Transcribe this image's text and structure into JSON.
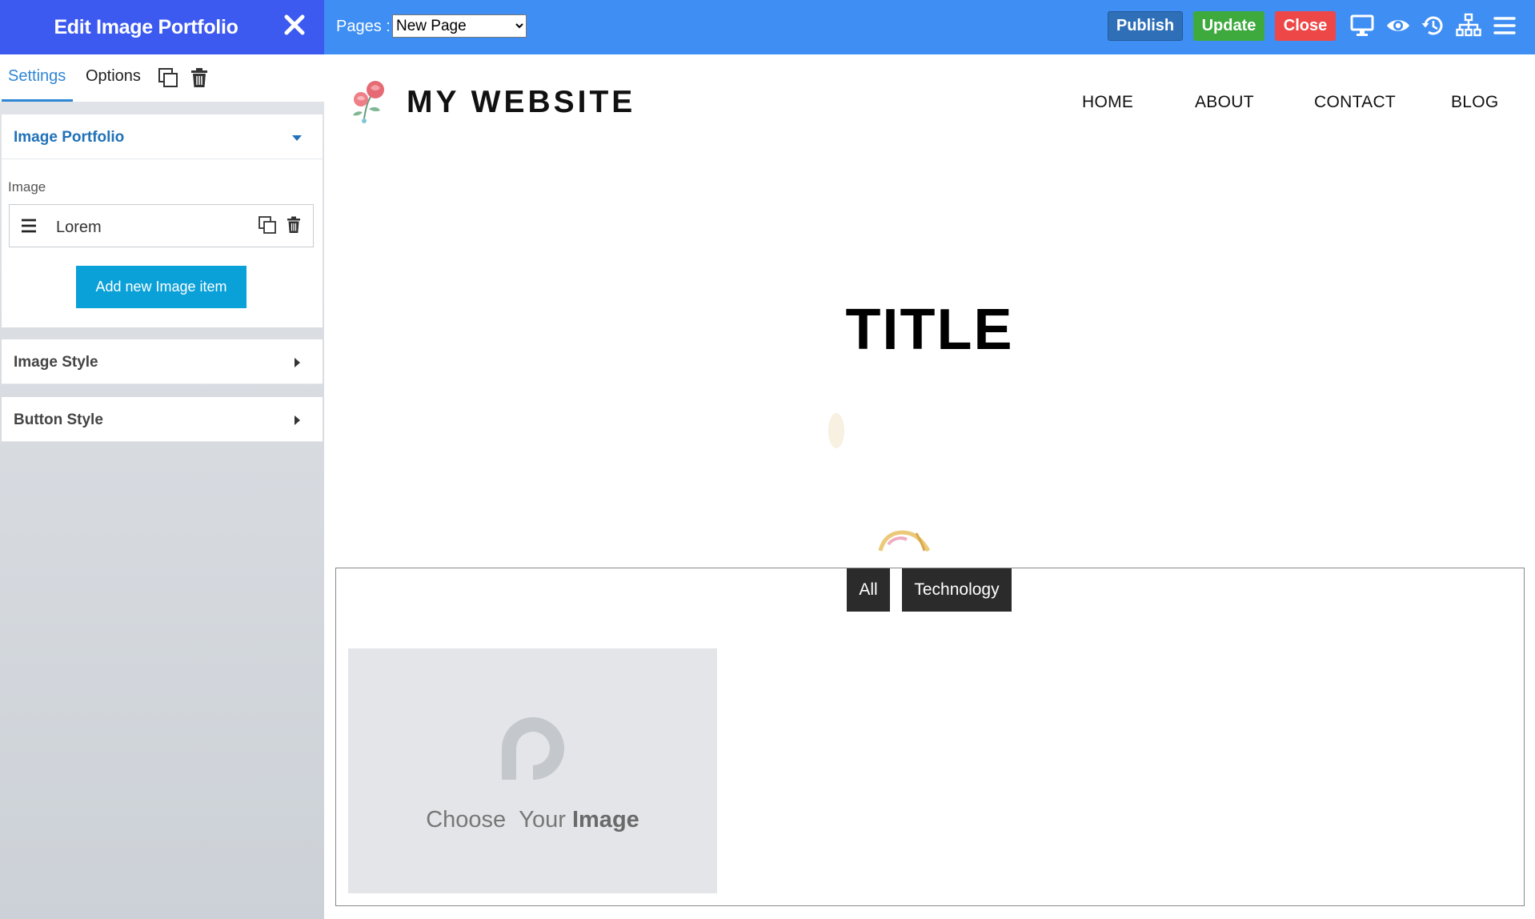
{
  "panel": {
    "title": "Edit Image Portfolio",
    "tabs": {
      "settings": "Settings",
      "options": "Options"
    },
    "sections": {
      "image_portfolio": "Image Portfolio",
      "image_style": "Image Style",
      "button_style": "Button Style"
    },
    "image_field_label": "Image",
    "items": [
      {
        "label": "Lorem"
      }
    ],
    "add_button": "Add new Image item",
    "collapse_glyph": "‹"
  },
  "topbar": {
    "pages_label": "Pages :",
    "pages_selected": "New Page",
    "buttons": {
      "publish": "Publish",
      "update": "Update",
      "close": "Close"
    },
    "icons": [
      "desktop-icon",
      "eye-icon",
      "history-icon",
      "sitemap-icon",
      "menu-icon"
    ]
  },
  "site": {
    "name": "MY WEBSITE",
    "nav": [
      "HOME",
      "ABOUT",
      "CONTACT",
      "BLOG"
    ],
    "hero_title": "TITLE"
  },
  "portfolio": {
    "filters": [
      "All",
      "Technology"
    ],
    "placeholder_words": [
      "Choose",
      "Your",
      "Image"
    ]
  },
  "colors": {
    "panel_header": "#3d5af0",
    "topbar": "#3e8ef3",
    "publish": "#2f6fb8",
    "update": "#3eaa3e",
    "close": "#ee4747",
    "add_button": "#0aa0d8",
    "active_tab": "#2f86d6"
  }
}
